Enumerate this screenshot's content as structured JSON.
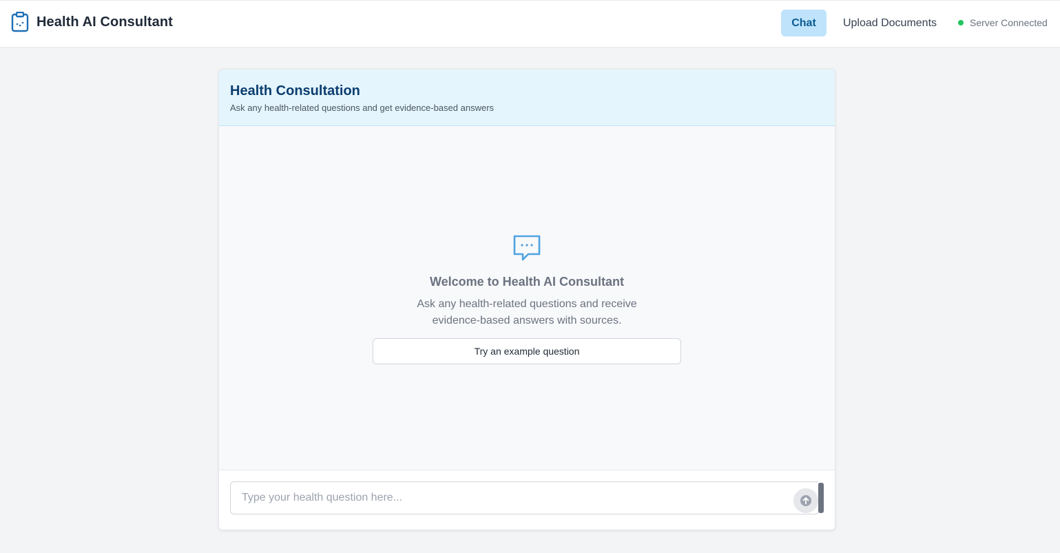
{
  "app": {
    "title": "Health AI Consultant",
    "icons": {
      "logo": "clipboard-icon",
      "welcome": "chat-bubble-icon",
      "send": "arrow-up-icon"
    },
    "colors": {
      "accent": "#0b5b92",
      "brand": "#1d6fb8",
      "status_ok": "#22c55e"
    }
  },
  "nav": {
    "chat_label": "Chat",
    "upload_label": "Upload Documents",
    "active": "Chat"
  },
  "status": {
    "label": "Server Connected"
  },
  "consultation": {
    "title": "Health Consultation",
    "subtitle": "Ask any health-related questions and get evidence-based answers"
  },
  "welcome": {
    "title": "Welcome to Health AI Consultant",
    "text": "Ask any health-related questions and receive evidence-based answers with sources.",
    "example_button": "Try an example question"
  },
  "composer": {
    "placeholder": "Type your health question here...",
    "value": ""
  }
}
